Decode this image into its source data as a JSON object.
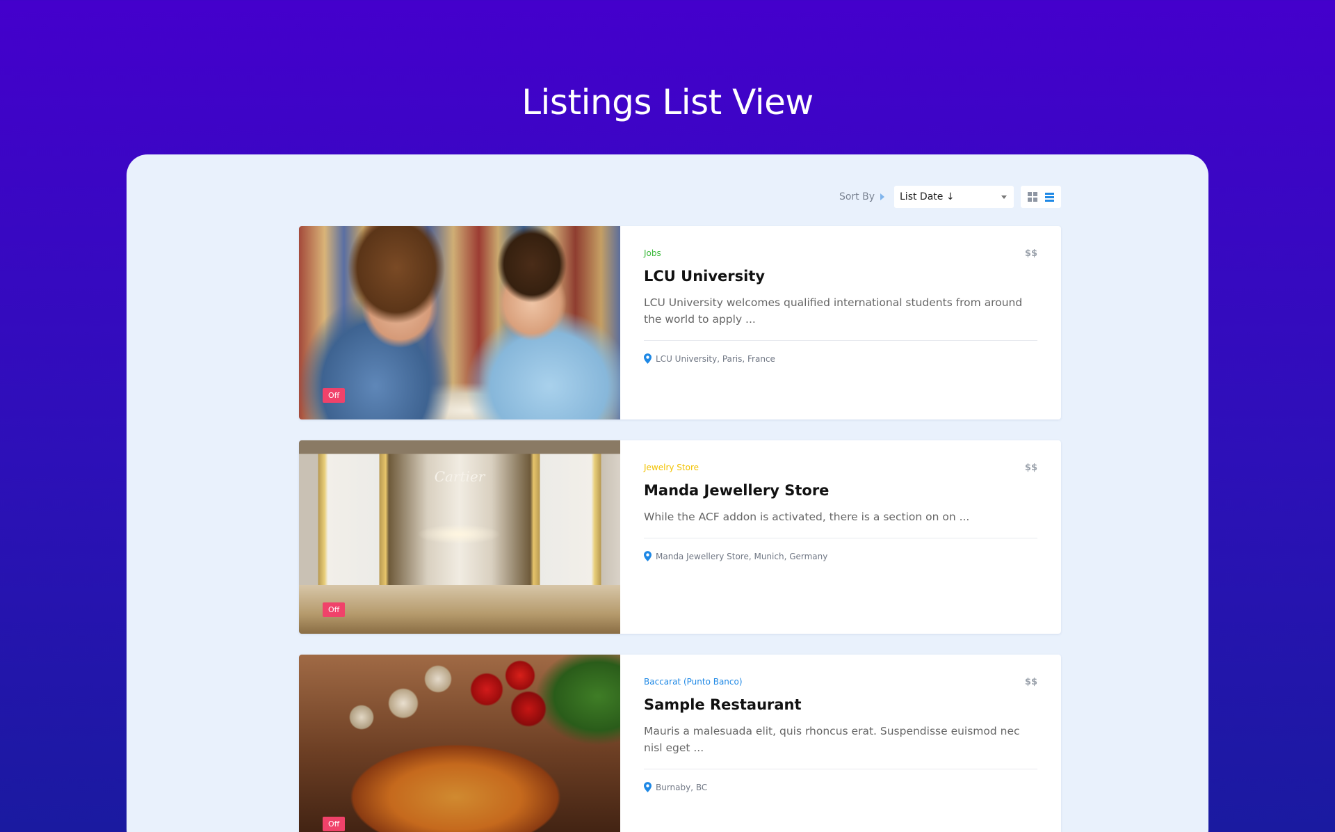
{
  "page": {
    "title": "Listings List View"
  },
  "toolbar": {
    "sort_label": "Sort By",
    "sort_value": "List Date ↓",
    "views": [
      "grid-view",
      "list-view"
    ],
    "active_view": "list-view"
  },
  "listings": [
    {
      "category": "Jobs",
      "category_color": "#3cb93c",
      "price": "$$",
      "title": "LCU University",
      "description": "LCU University welcomes qualified international students from around the world to apply ...",
      "location": "LCU University, Paris, France",
      "badge": "Off"
    },
    {
      "category": "Jewelry Store",
      "category_color": "#f2c200",
      "price": "$$",
      "title": "Manda Jewellery Store",
      "description": "While the ACF addon is activated, there is a section on on ...",
      "location": "Manda Jewellery Store, Munich, Germany",
      "badge": "Off",
      "image_text": "Cartier"
    },
    {
      "category": "Baccarat (Punto Banco)",
      "category_color": "#1e88e5",
      "price": "$$",
      "title": "Sample Restaurant",
      "description": "Mauris a malesuada elit, quis rhoncus erat. Suspendisse euismod nec nisl eget ...",
      "location": "Burnaby, BC",
      "badge": "Off"
    }
  ],
  "colors": {
    "accent": "#1e88e5",
    "badge": "#f0426a",
    "background_top": "#4400cc",
    "panel": "#e9f1fc"
  }
}
